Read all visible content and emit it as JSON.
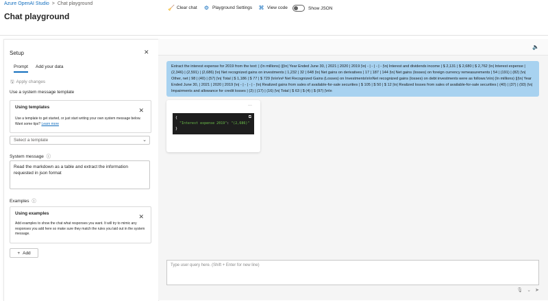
{
  "breadcrumb": {
    "root": "Azure OpenAI Studio",
    "separator": ">",
    "current": "Chat playground"
  },
  "page_title": "Chat playground",
  "toolbar": {
    "clear_chat": "Clear chat",
    "playground_settings": "Playground Settings",
    "view_code": "View code",
    "show_json": "Show JSON",
    "show_json_on": false
  },
  "setup": {
    "title": "Setup",
    "tabs": [
      "Prompt",
      "Add your data"
    ],
    "apply_changes": "Apply changes",
    "system_template_label": "Use a system message template",
    "templates_card": {
      "title": "Using templates",
      "body": "Use a template to get started, or just start writing your own system message below. Want some tips?",
      "link": "Learn more"
    },
    "select_placeholder": "Select a template",
    "system_message_label": "System message",
    "system_message_value": "Read the markdown as a table and extract the information requested in json format",
    "examples_label": "Examples",
    "examples_card": {
      "title": "Using examples",
      "body": "Add examples to show the chat what responses you want. It will try to mimic any responses you add here so make sure they match the rules you laid out in the system message."
    },
    "add_button": "Add"
  },
  "chat": {
    "user_message": "Extract the interest expense for 2019 from the text: | (In millions) |||\\n| Year Ended June 30, | 2021 | 2020 | 2019 |\\n| - | - | - | - |\\n| Interest and dividends income | $ 2,131 | $ 2,680 | $ 2,762 |\\n| Interest expense | (2,346) | (2,591) | (2,686) |\\n| Net recognized gains on investments | 1,232 | 32 | 648 |\\n| Net gains on derivatives | 17 | 187 | 144 |\\n| Net gains (losses) on foreign currency remeasurements | 54 | (191) | (82) |\\n| Other, net | 98 | (40) | (57) |\\n| Total | $ 1,186 | $ 77 | $ 729 |\\n\\n\\n# Net Recognized Gains (Losses) on Investments\\n\\nNet recognized gains (losses) on debt investments were as follows:\\n\\n| (In millions) |||\\n| Year Ended June 30, | 2021 | 2020 | 2019 |\\n| - | - | - | - |\\n| Realized gains from sales of available-for-sale securities | $ 105 | $ 50 | $ 12 |\\n| Realized losses from sales of available-for-sale securities | (40) | (37) | (93) |\\n| Impairments and allowance for credit losses | (2) | (17) | (16) |\\n| Total | $ 63 | $ (4) | $ (97) |\\n\\n",
    "response": {
      "open": "{",
      "key": "\"Interest expense 2019\"",
      "colon": ": ",
      "value": "\"(2,686)\"",
      "close": "}"
    },
    "input_placeholder": "Type user query here. (Shift + Enter for new line)"
  },
  "colors": {
    "accent": "#0f6cbd",
    "user_bubble": "#a8d2f0",
    "code_bg": "#1e1e1e",
    "main_bg": "#f5f5f5"
  }
}
